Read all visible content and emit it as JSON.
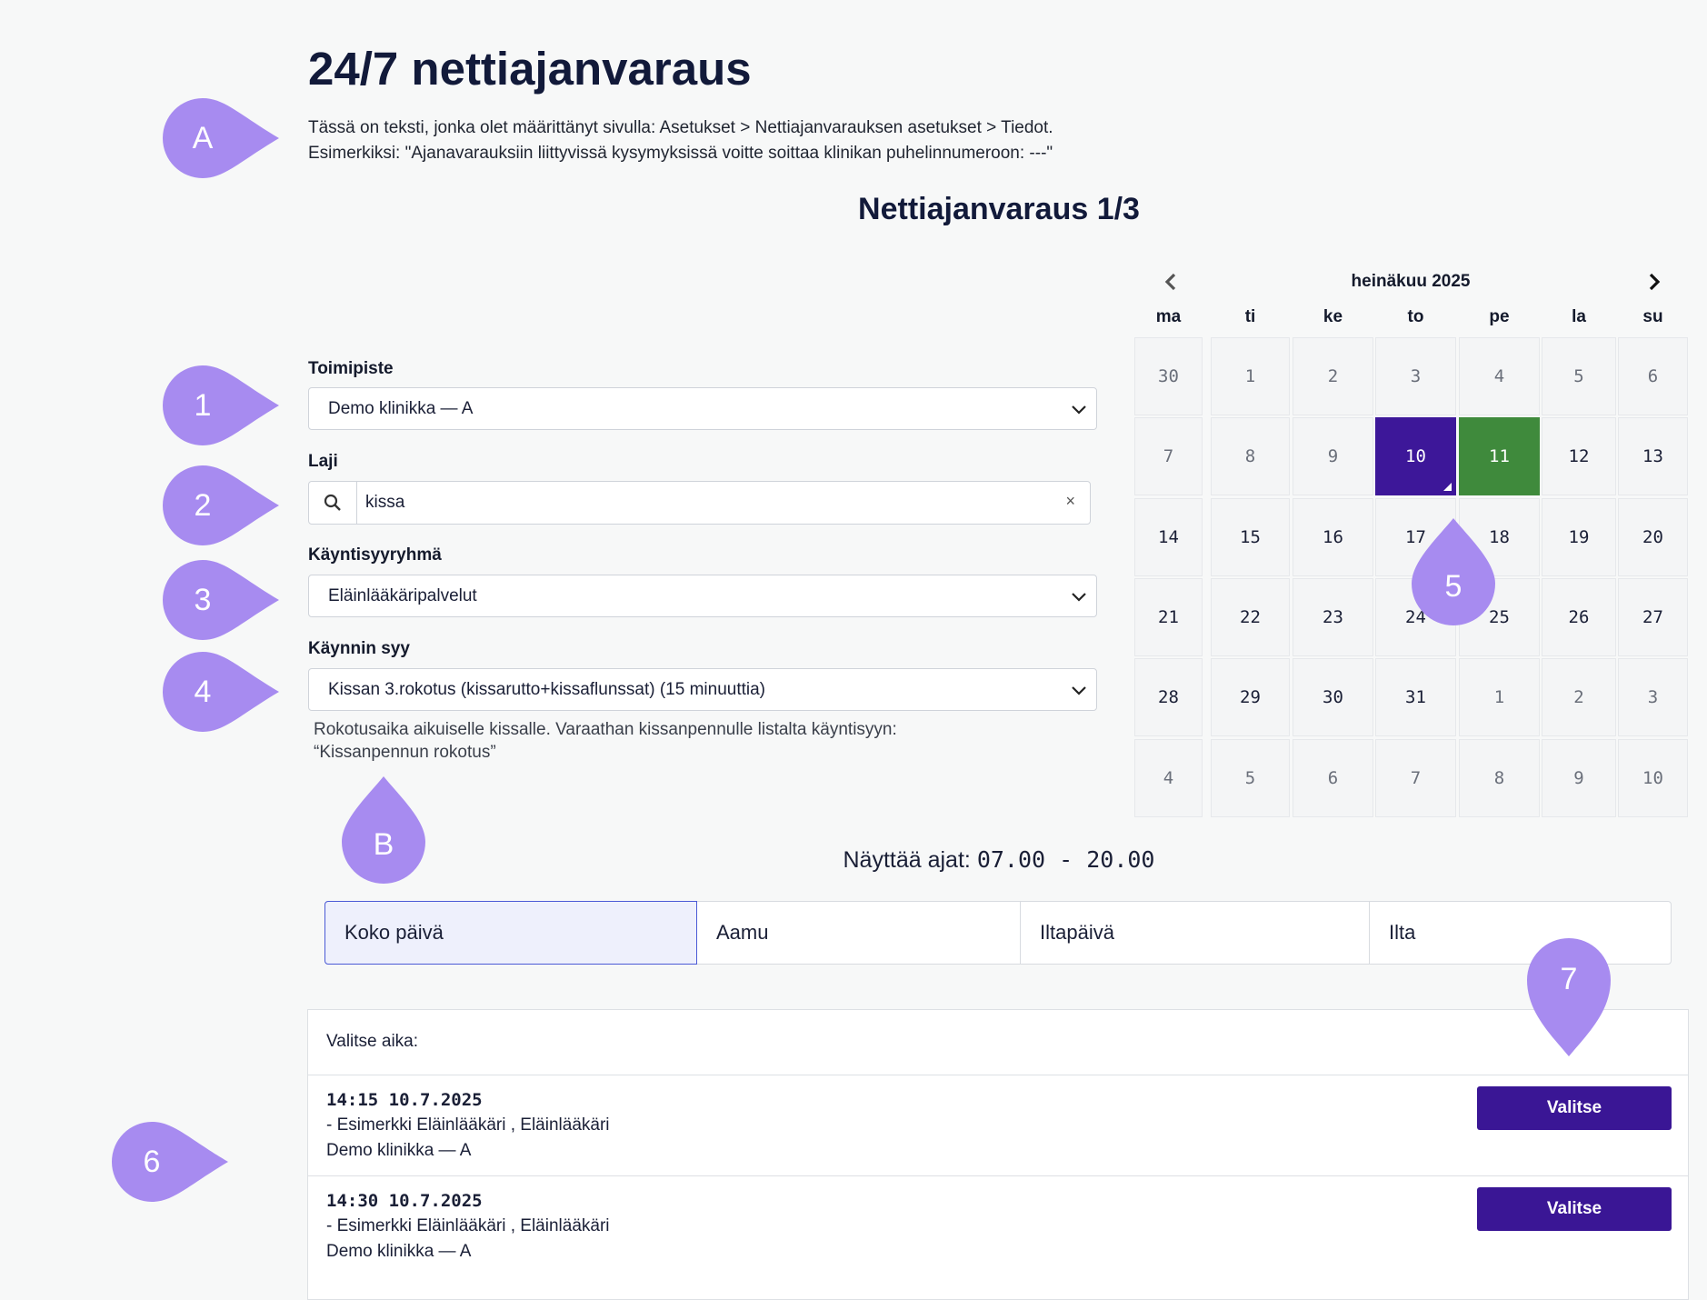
{
  "header": {
    "title": "24/7 nettiajanvaraus",
    "intro_line1": "Tässä on teksti, jonka olet määrittänyt sivulla: Asetukset > Nettiajanvarauksen asetukset > Tiedot.",
    "intro_line2": "Esimerkiksi: \"Ajanavarauksiin liittyvissä kysymyksissä voitte soittaa klinikan puhelinnumeroon: ---\"",
    "step_title": "Nettiajanvaraus 1/3"
  },
  "form": {
    "toimipiste": {
      "label": "Toimipiste",
      "value": "Demo klinikka — A"
    },
    "laji": {
      "label": "Laji",
      "value": "kissa",
      "clear": "×"
    },
    "kayntisyyryhma": {
      "label": "Käyntisyyryhmä",
      "value": "Eläinlääkäripalvelut"
    },
    "kaynnin_syy": {
      "label": "Käynnin syy",
      "value": "Kissan 3.rokotus (kissarutto+kissaflunssat) (15 minuuttia)"
    },
    "description_line1": "Rokotusaika aikuiselle kissalle. Varaathan kissanpennulle listalta käyntisyyn:",
    "description_line2": "“Kissanpennun rokotus”"
  },
  "calendar": {
    "month": "heinäkuu 2025",
    "weekdays": [
      "ma",
      "ti",
      "ke",
      "to",
      "pe",
      "la",
      "su"
    ],
    "weeks": [
      [
        "30",
        "1",
        "2",
        "3",
        "4",
        "5",
        "6"
      ],
      [
        "7",
        "8",
        "9",
        "10",
        "11",
        "12",
        "13"
      ],
      [
        "14",
        "15",
        "16",
        "17",
        "18",
        "19",
        "20"
      ],
      [
        "21",
        "22",
        "23",
        "24",
        "25",
        "26",
        "27"
      ],
      [
        "28",
        "29",
        "30",
        "31",
        "1",
        "2",
        "3"
      ],
      [
        "4",
        "5",
        "6",
        "7",
        "8",
        "9",
        "10"
      ]
    ],
    "muted_cells": [
      [
        0,
        0
      ],
      [
        0,
        1
      ],
      [
        0,
        2
      ],
      [
        0,
        3
      ],
      [
        0,
        4
      ],
      [
        0,
        5
      ],
      [
        0,
        6
      ],
      [
        1,
        0
      ],
      [
        1,
        1
      ],
      [
        1,
        2
      ],
      [
        4,
        4
      ],
      [
        4,
        5
      ],
      [
        4,
        6
      ],
      [
        5,
        0
      ],
      [
        5,
        1
      ],
      [
        5,
        2
      ],
      [
        5,
        3
      ],
      [
        5,
        4
      ],
      [
        5,
        5
      ],
      [
        5,
        6
      ]
    ],
    "selected_cell": [
      1,
      3
    ],
    "available_cell": [
      1,
      4
    ],
    "selected_color": "#3d1799",
    "available_color": "#3f8a3c"
  },
  "times": {
    "prefix": "Näyttää ajat: ",
    "range": "07.00 - 20.00"
  },
  "tabs": [
    "Koko päivä",
    "Aamu",
    "Iltapäivä",
    "Ilta"
  ],
  "slots": {
    "heading": "Valitse aika:",
    "items": [
      {
        "when": "14:15 10.7.2025",
        "who": "- Esimerkki Eläinlääkäri , Eläinlääkäri",
        "where": "Demo klinikka — A",
        "button": "Valitse"
      },
      {
        "when": "14:30 10.7.2025",
        "who": "- Esimerkki Eläinlääkäri , Eläinlääkäri",
        "where": "Demo klinikka — A",
        "button": "Valitse"
      }
    ]
  },
  "markers": [
    "A",
    "1",
    "2",
    "3",
    "4",
    "B",
    "5",
    "7",
    "6"
  ],
  "colors": {
    "marker": "#a78bf0",
    "primary": "#3a1695",
    "title": "#121a3a"
  }
}
